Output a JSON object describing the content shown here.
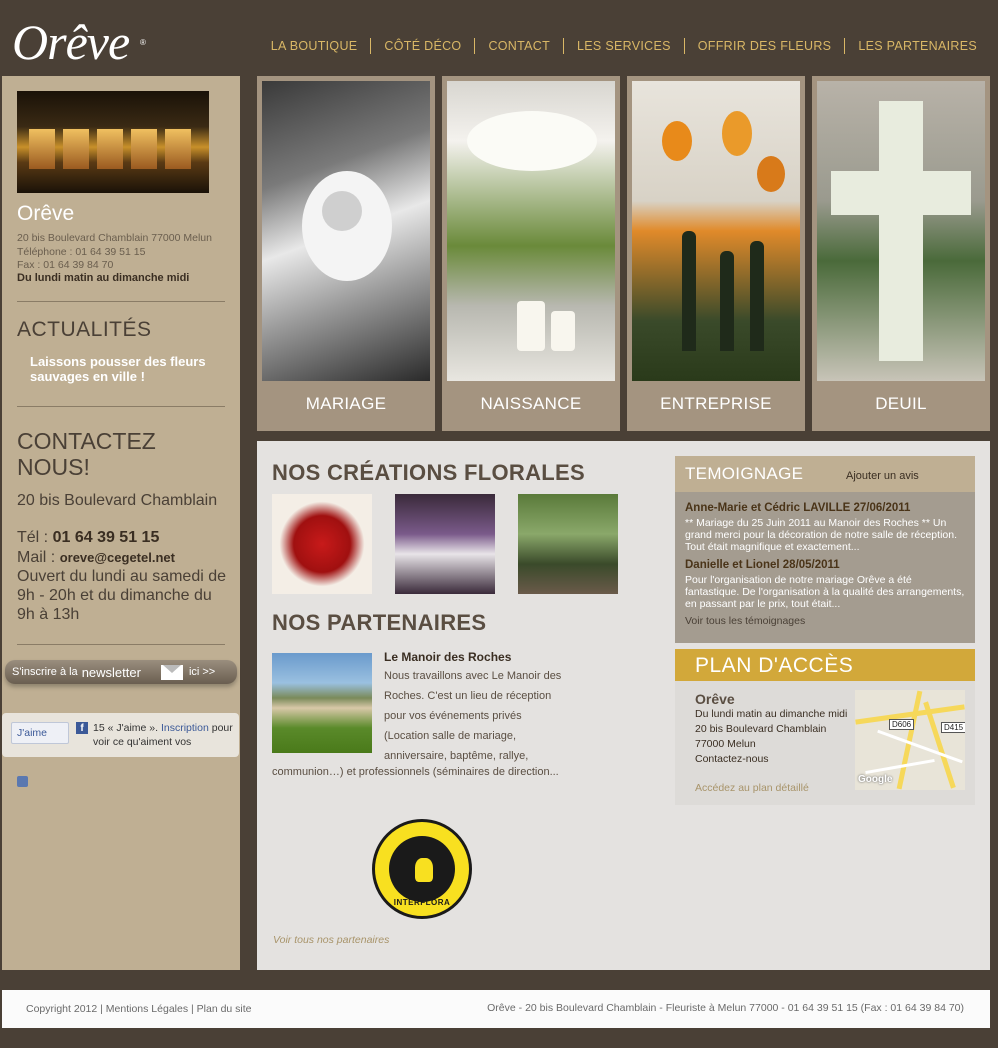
{
  "header": {
    "logo": "Orêve",
    "logo_mark": "®",
    "nav": [
      "LA BOUTIQUE",
      "CÔTÉ DÉCO",
      "CONTACT",
      "LES SERVICES",
      "OFFRIR DES FLEURS",
      "LES PARTENAIRES"
    ]
  },
  "sidebar": {
    "name": "Orêve",
    "address_line": "20 bis Boulevard Chamblain 77000 Melun",
    "phone_line": "Téléphone : 01 64 39 51 15",
    "fax_line": "Fax : 01 64 39 84 70",
    "hours": "Du lundi matin au dimanche midi",
    "actu_title": "ACTUALITÉS",
    "actu_item": "Laissons pousser des fleurs sauvages en ville !",
    "contact_title": "CONTACTEZ NOUS!",
    "contact_address": "20 bis Boulevard Chamblain",
    "tel_label": "Tél :",
    "tel": "01 64 39 51 15",
    "mail_label": "Mail :",
    "mail": "oreve@cegetel.net",
    "open": "Ouvert du lundi au samedi de 9h - 20h et du dimanche du 9h à 13h",
    "newsletter_prefix": "S'inscrire à la",
    "newsletter_word": "newsletter",
    "newsletter_suffix": "ici >>",
    "fb_like": "J'aime",
    "fb_count": "15 « J'aime ».",
    "fb_signup": "Inscription",
    "fb_rest": "pour voir ce qu'aiment vos"
  },
  "categories": [
    "MARIAGE",
    "NAISSANCE",
    "ENTREPRISE",
    "DEUIL"
  ],
  "main": {
    "creations_title": "NOS CRÉATIONS FLORALES",
    "partners_title": "NOS PARTENAIRES",
    "partner_name": "Le Manoir des Roches",
    "partner_desc": "Nous travaillons avec Le Manoir des Roches. C'est un lieu de réception pour vos événements privés (Location salle de mariage, anniversaire, baptême, rallye,",
    "partner_desc2": "communion…) et professionnels (séminaires de direction...",
    "interflora_text": "INTERFLORA",
    "see_partners": "Voir tous nos partenaires"
  },
  "testimonials": {
    "title": "TEMOIGNAGE",
    "add": "Ajouter un avis",
    "items": [
      {
        "name": "Anne-Marie et Cédric LAVILLE 27/06/2011",
        "text": "** Mariage du 25 Juin 2011 au Manoir des Roches ** Un grand merci pour la décoration de notre salle de réception. Tout était magnifique et exactement..."
      },
      {
        "name": "Danielle et Lionel 28/05/2011",
        "text": "Pour l'organisation de notre mariage Orêve a été fantastique. De l'organisation à la qualité des arrangements, en passant par le prix, tout était..."
      }
    ],
    "see_all": "Voir tous les témoignages"
  },
  "access": {
    "title": "PLAN D'ACCÈS",
    "name": "Orêve",
    "lines": [
      "Du lundi matin au dimanche midi",
      "20 bis Boulevard Chamblain",
      "77000 Melun",
      "Contactez-nous"
    ],
    "link": "Accédez au plan détaillé",
    "map_tags": [
      "D606",
      "D415"
    ],
    "map_brand": "Google"
  },
  "footer": {
    "left": "Copyright   2012 | Mentions Légales | Plan du site",
    "right": "Orêve - 20 bis Boulevard Chamblain - Fleuriste à Melun 77000 - 01 64 39 51 15 (Fax : 01 64 39 84 70)"
  }
}
